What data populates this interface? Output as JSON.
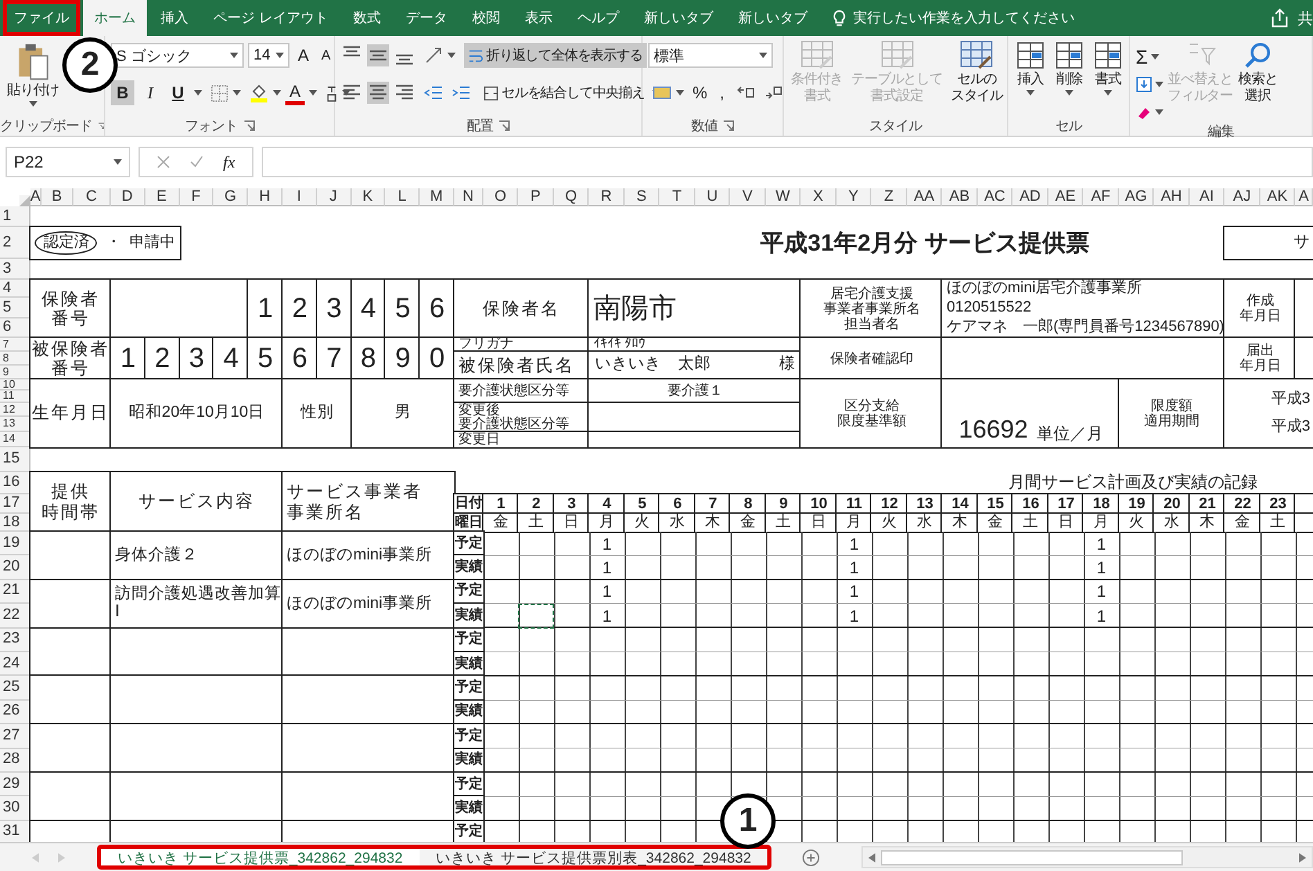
{
  "ribbon_tabs": [
    {
      "label": "ファイル",
      "selected": false,
      "highlighted": true
    },
    {
      "label": "ホーム",
      "selected": true,
      "highlighted": false
    },
    {
      "label": "挿入",
      "selected": false,
      "highlighted": false
    },
    {
      "label": "ページ レイアウト",
      "selected": false,
      "highlighted": false
    },
    {
      "label": "数式",
      "selected": false,
      "highlighted": false
    },
    {
      "label": "データ",
      "selected": false,
      "highlighted": false
    },
    {
      "label": "校閲",
      "selected": false,
      "highlighted": false
    },
    {
      "label": "表示",
      "selected": false,
      "highlighted": false
    },
    {
      "label": "ヘルプ",
      "selected": false,
      "highlighted": false
    },
    {
      "label": "新しいタブ",
      "selected": false,
      "highlighted": false
    },
    {
      "label": "新しいタブ",
      "selected": false,
      "highlighted": false
    }
  ],
  "tell_me": {
    "placeholder": "実行したい作業を入力してください"
  },
  "share": {
    "label": "共"
  },
  "clipboard": {
    "paste": "貼り付け",
    "label": "クリップボード"
  },
  "font": {
    "name": "S ゴシック",
    "size": "14",
    "grow": "A",
    "shrink": "A",
    "text_color_button": "A",
    "label": "フォント",
    "buttons": [
      {
        "label": "B",
        "pressed": true
      },
      {
        "label": "I",
        "pressed": false
      },
      {
        "label": "U",
        "pressed": false
      }
    ]
  },
  "alignment": {
    "label": "配置",
    "merge": "セルを結合して中央揃え",
    "wrap": {
      "label": "折り返して全体を表示する",
      "pressed": true
    },
    "buttons": [
      {
        "kind": "top",
        "pressed": false
      },
      {
        "kind": "middle",
        "pressed": true
      },
      {
        "kind": "bottom",
        "pressed": false
      },
      {
        "kind": "left",
        "pressed": false
      },
      {
        "kind": "center",
        "pressed": true
      },
      {
        "kind": "right",
        "pressed": false
      }
    ]
  },
  "number": {
    "format": "標準",
    "percent": "%",
    "comma": ",",
    "label": "数値"
  },
  "styles": {
    "label": "スタイル",
    "buttons": [
      {
        "lines": [
          "条件付き",
          "書式"
        ],
        "disabled": true
      },
      {
        "lines": [
          "テーブルとして",
          "書式設定"
        ],
        "disabled": true
      },
      {
        "lines": [
          "セルの",
          "スタイル"
        ],
        "disabled": false
      }
    ]
  },
  "cells": {
    "label": "セル",
    "buttons": [
      {
        "label": "挿入"
      },
      {
        "label": "削除"
      },
      {
        "label": "書式"
      }
    ]
  },
  "editing": {
    "label": "編集",
    "sum": "Σ",
    "buttons": [
      {
        "lines": [
          "並べ替えと",
          "フィルター"
        ],
        "disabled": true
      },
      {
        "lines": [
          "検索と",
          "選択"
        ],
        "disabled": false
      }
    ]
  },
  "formula_bar": {
    "cell": "P22",
    "function_label": "fx"
  },
  "column_headers": [
    "A",
    "B",
    "C",
    "D",
    "E",
    "F",
    "G",
    "H",
    "I",
    "J",
    "K",
    "L",
    "M",
    "N",
    "O",
    "P",
    "Q",
    "R",
    "S",
    "T",
    "U",
    "V",
    "W",
    "X",
    "Y",
    "Z",
    "AA",
    "AB",
    "AC",
    "AD",
    "AE",
    "AF",
    "AG",
    "AH",
    "AI",
    "AJ",
    "AK",
    "A"
  ],
  "row_headers": [
    "1",
    "2",
    "3",
    "4",
    "5",
    "6",
    "7",
    "8",
    "9",
    "10",
    "11",
    "12",
    "13",
    "14",
    "15",
    "16",
    "17",
    "18",
    "19",
    "20",
    "21",
    "22",
    "23",
    "24",
    "25",
    "26",
    "27",
    "28",
    "29",
    "30",
    "31"
  ],
  "sheet": {
    "status": {
      "certified": {
        "label": "認定済",
        "circled": true
      },
      "separator": "・",
      "applying": {
        "label": "申請中",
        "circled": false
      }
    },
    "title": "平成31年2月分 サービス提供票",
    "corner_box": "サ",
    "insurer": {
      "label": [
        "保険者",
        "番号"
      ],
      "digits": [
        "1",
        "2",
        "3",
        "4",
        "5",
        "6"
      ],
      "name_label": "保険者名",
      "name": "南陽市"
    },
    "provider": {
      "label": [
        "居宅介護支援",
        "事業者事業所名",
        "担当者名"
      ],
      "lines": [
        "ほのぼのmini居宅介護事業所",
        "0120515522",
        "ケアマネ　一郎(専門員番号1234567890)"
      ],
      "created_label": [
        "作成",
        "年月日"
      ],
      "confirm_label": "保険者確認印",
      "filed_label": [
        "届出",
        "年月日"
      ]
    },
    "insured": {
      "label": [
        "被保険者",
        "番号"
      ],
      "digits": [
        "1",
        "2",
        "3",
        "4",
        "5",
        "6",
        "7",
        "8",
        "9",
        "0"
      ],
      "furigana_label": "フリガナ",
      "furigana": "ｲｷｲｷ ﾀﾛｳ",
      "name_label": "被保険者氏名",
      "name": "いきいき　太郎",
      "honorific": "様"
    },
    "birth": {
      "label": "生年月日",
      "value": "昭和20年10月10日",
      "sex_label": "性別",
      "sex": "男"
    },
    "care": {
      "label": "要介護状態区分等",
      "value": "要介護１",
      "changed_label": [
        "変更後",
        "要介護状態区分等"
      ],
      "change_date_label": "変更日"
    },
    "limit": {
      "label": [
        "区分支給",
        "限度基準額"
      ],
      "amount": "16692",
      "unit": "単位／月",
      "period_label": [
        "限度額",
        "適用期間"
      ],
      "period": [
        "平成3",
        "平成3"
      ]
    },
    "schedule": {
      "time_label": [
        "提供",
        "時間帯"
      ],
      "content_label": "サービス内容",
      "provider_label": [
        "サービス事業者",
        "事業所名"
      ],
      "title": "月間サービス計画及び実績の記録",
      "date_label": "日付",
      "weekday_label": "曜日",
      "days": [
        {
          "date": "1",
          "weekday": "金"
        },
        {
          "date": "2",
          "weekday": "土"
        },
        {
          "date": "3",
          "weekday": "日"
        },
        {
          "date": "4",
          "weekday": "月"
        },
        {
          "date": "5",
          "weekday": "火"
        },
        {
          "date": "6",
          "weekday": "水"
        },
        {
          "date": "7",
          "weekday": "木"
        },
        {
          "date": "8",
          "weekday": "金"
        },
        {
          "date": "9",
          "weekday": "土"
        },
        {
          "date": "10",
          "weekday": "日"
        },
        {
          "date": "11",
          "weekday": "月"
        },
        {
          "date": "12",
          "weekday": "火"
        },
        {
          "date": "13",
          "weekday": "水"
        },
        {
          "date": "14",
          "weekday": "木"
        },
        {
          "date": "15",
          "weekday": "金"
        },
        {
          "date": "16",
          "weekday": "土"
        },
        {
          "date": "17",
          "weekday": "日"
        },
        {
          "date": "18",
          "weekday": "月"
        },
        {
          "date": "19",
          "weekday": "火"
        },
        {
          "date": "20",
          "weekday": "水"
        },
        {
          "date": "21",
          "weekday": "木"
        },
        {
          "date": "22",
          "weekday": "金"
        },
        {
          "date": "23",
          "weekday": "土"
        }
      ],
      "services": [
        {
          "content": "身体介護２",
          "provider": "ほのぼのmini事業所",
          "rows": [
            {
              "label": "予定",
              "cells": [
                null,
                null,
                null,
                {
                  "value": "1"
                },
                null,
                null,
                null,
                null,
                null,
                null,
                {
                  "value": "1"
                },
                null,
                null,
                null,
                null,
                null,
                null,
                {
                  "value": "1"
                },
                null,
                null,
                null,
                null,
                null
              ]
            },
            {
              "label": "実績",
              "cells": [
                null,
                null,
                null,
                {
                  "value": "1"
                },
                null,
                null,
                null,
                null,
                null,
                null,
                {
                  "value": "1"
                },
                null,
                null,
                null,
                null,
                null,
                null,
                {
                  "value": "1"
                },
                null,
                null,
                null,
                null,
                null
              ]
            }
          ]
        },
        {
          "content": "訪問介護処遇改善加算Ⅰ",
          "provider": "ほのぼのmini事業所",
          "rows": [
            {
              "label": "予定",
              "cells": [
                null,
                null,
                null,
                {
                  "value": "1"
                },
                null,
                null,
                null,
                null,
                null,
                null,
                {
                  "value": "1"
                },
                null,
                null,
                null,
                null,
                null,
                null,
                {
                  "value": "1"
                },
                null,
                null,
                null,
                null,
                null
              ]
            },
            {
              "label": "実績",
              "cells": [
                null,
                {
                  "marquee": true
                },
                null,
                {
                  "value": "1"
                },
                null,
                null,
                null,
                null,
                null,
                null,
                {
                  "value": "1"
                },
                null,
                null,
                null,
                null,
                null,
                null,
                {
                  "value": "1"
                },
                null,
                null,
                null,
                null,
                null
              ]
            }
          ]
        },
        {
          "rows": [
            {
              "label": "予定"
            },
            {
              "label": "実績"
            }
          ]
        },
        {
          "rows": [
            {
              "label": "予定"
            },
            {
              "label": "実績"
            }
          ]
        },
        {
          "rows": [
            {
              "label": "予定"
            },
            {
              "label": "実績"
            }
          ]
        },
        {
          "rows": [
            {
              "label": "予定"
            },
            {
              "label": "実績"
            }
          ]
        },
        {
          "rows": [
            {
              "label": "予定"
            }
          ]
        }
      ]
    }
  },
  "sheet_tabs": {
    "highlighted": true,
    "tabs": [
      {
        "label": "いきいき サービス提供票_342862_294832",
        "selected": true
      },
      {
        "label": "いきいき サービス提供票別表_342862_294832",
        "selected": false
      }
    ]
  },
  "callouts": [
    {
      "number": "2"
    },
    {
      "number": "1"
    }
  ]
}
